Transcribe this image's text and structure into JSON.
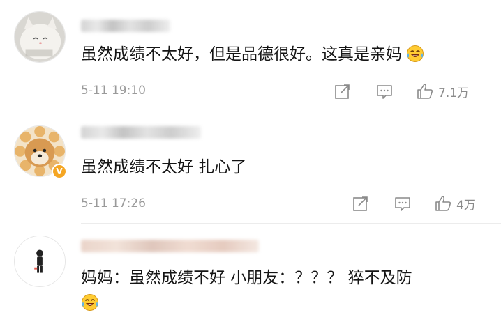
{
  "colors": {
    "text": "#151515",
    "meta": "#9a9a9a",
    "icon": "#8a8a8a",
    "verified_badge": "#f5a623",
    "divider": "#ececec"
  },
  "comments": [
    {
      "username": "",
      "username_blurred": true,
      "avatar": "white-cat-avatar",
      "text": "虽然成绩不太好，但是品德很好。这真是亲妈",
      "emoji": "laughing-tears-emoji",
      "timestamp": "5-11 19:10",
      "likes": "7.1万"
    },
    {
      "username": "",
      "username_blurred": true,
      "avatar": "shiba-dog-avatar",
      "verified": true,
      "verified_mark": "V",
      "text": "虽然成绩不太好 扎心了",
      "timestamp": "5-11 17:26",
      "likes": "4万"
    },
    {
      "username": "",
      "username_blurred": true,
      "avatar": "cartoon-figure-avatar",
      "text": "妈妈：虽然成绩不好 小朋友：？？？ 猝不及防",
      "emoji": "laughing-tears-emoji"
    }
  ]
}
